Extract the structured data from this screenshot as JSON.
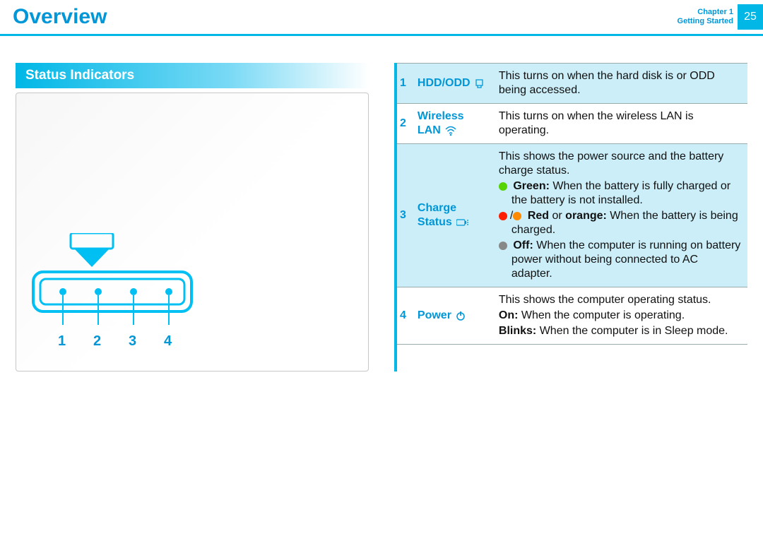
{
  "header": {
    "title": "Overview",
    "chapter_line1": "Chapter 1",
    "chapter_line2": "Getting Started",
    "page_number": "25"
  },
  "section_title": "Status Indicators",
  "diagram": {
    "led_labels": [
      "1",
      "2",
      "3",
      "4"
    ]
  },
  "indicators": [
    {
      "num": "1",
      "name": "HDD/ODD",
      "icon": "hdd-icon",
      "desc_lines": [
        {
          "type": "plain",
          "text": "This turns on when the hard disk is or ODD being accessed."
        }
      ]
    },
    {
      "num": "2",
      "name": "Wireless LAN",
      "icon": "wifi-icon",
      "desc_lines": [
        {
          "type": "plain",
          "text": "This turns on when the wireless LAN is operating."
        }
      ]
    },
    {
      "num": "3",
      "name": "Charge Status",
      "icon": "charge-icon",
      "desc_lines": [
        {
          "type": "plain",
          "text": "This shows the power source and the battery charge status."
        },
        {
          "type": "bullet",
          "dot": "green",
          "bold": "Green:",
          "text": " When the battery is fully charged or the battery is not installed."
        },
        {
          "type": "bullet2",
          "dot1": "red",
          "dot2": "orange",
          "bold": "Red",
          "mid": " or ",
          "bold2": "orange:",
          "text": " When the battery is being charged."
        },
        {
          "type": "bullet",
          "dot": "off",
          "bold": "Off:",
          "text": " When the computer is running on battery power without being connected to AC adapter."
        }
      ]
    },
    {
      "num": "4",
      "name": "Power",
      "icon": "power-icon",
      "desc_lines": [
        {
          "type": "plain",
          "text": "This shows the computer operating status."
        },
        {
          "type": "boldline",
          "bold": "On:",
          "text": " When the computer is operating."
        },
        {
          "type": "boldline",
          "bold": "Blinks:",
          "text": " When the computer is in Sleep mode."
        }
      ]
    }
  ]
}
